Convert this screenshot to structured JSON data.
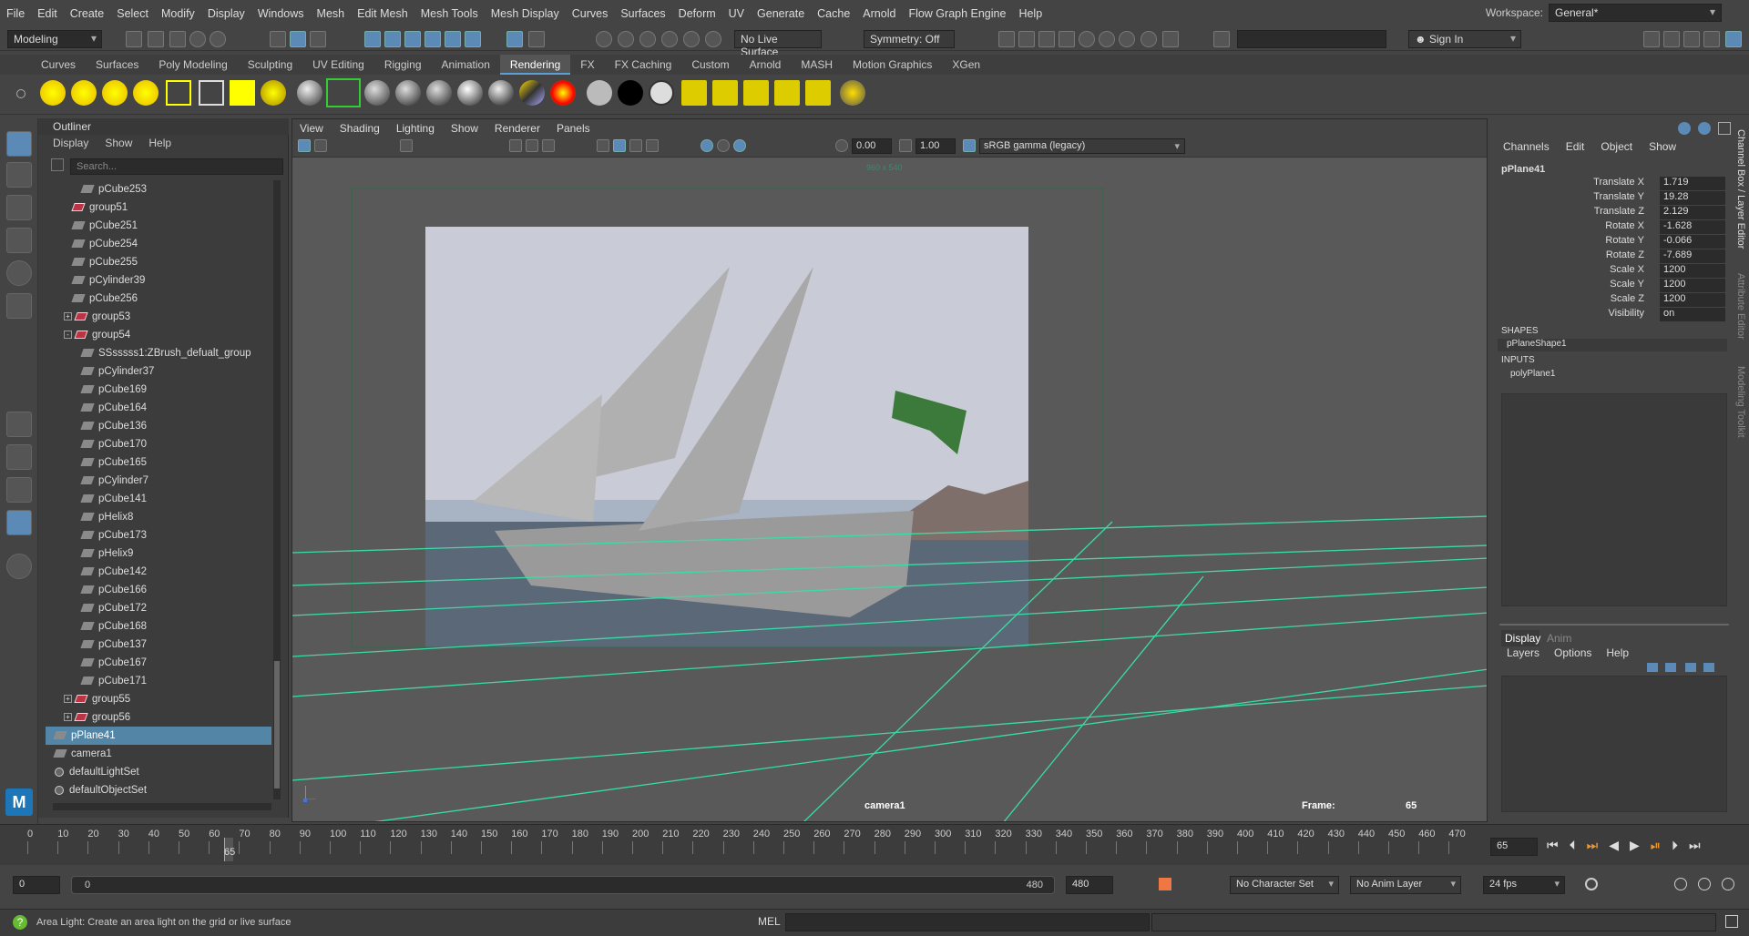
{
  "menubar": {
    "items": [
      "File",
      "Edit",
      "Create",
      "Select",
      "Modify",
      "Display",
      "Windows",
      "Mesh",
      "Edit Mesh",
      "Mesh Tools",
      "Mesh Display",
      "Curves",
      "Surfaces",
      "Deform",
      "UV",
      "Generate",
      "Cache",
      "Arnold",
      "Flow Graph Engine",
      "Help"
    ],
    "workspace_label": "Workspace:",
    "workspace_value": "General*"
  },
  "statusline": {
    "mode": "Modeling",
    "live_surface": "No Live Surface",
    "symmetry": "Symmetry: Off",
    "sign_in": "Sign In"
  },
  "shelf": {
    "tabs": [
      "Curves",
      "Surfaces",
      "Poly Modeling",
      "Sculpting",
      "UV Editing",
      "Rigging",
      "Animation",
      "Rendering",
      "FX",
      "FX Caching",
      "Custom",
      "Arnold",
      "MASH",
      "Motion Graphics",
      "XGen"
    ],
    "active_tab": "Rendering"
  },
  "outliner": {
    "title": "Outliner",
    "menu": [
      "Display",
      "Show",
      "Help"
    ],
    "search_placeholder": "Search...",
    "items": [
      {
        "label": "pCube253",
        "type": "mesh",
        "indent": 3
      },
      {
        "label": "group51",
        "type": "group",
        "indent": 2
      },
      {
        "label": "pCube251",
        "type": "mesh",
        "indent": 2
      },
      {
        "label": "pCube254",
        "type": "mesh",
        "indent": 2
      },
      {
        "label": "pCube255",
        "type": "mesh",
        "indent": 2
      },
      {
        "label": "pCylinder39",
        "type": "mesh",
        "indent": 2
      },
      {
        "label": "pCube256",
        "type": "mesh",
        "indent": 2
      },
      {
        "label": "group53",
        "type": "group",
        "indent": 1,
        "expand": "+"
      },
      {
        "label": "group54",
        "type": "group",
        "indent": 1,
        "expand": "-"
      },
      {
        "label": "SSsssss1:ZBrush_defualt_group",
        "type": "mesh",
        "indent": 3
      },
      {
        "label": "pCylinder37",
        "type": "mesh",
        "indent": 3
      },
      {
        "label": "pCube169",
        "type": "mesh",
        "indent": 3
      },
      {
        "label": "pCube164",
        "type": "mesh",
        "indent": 3
      },
      {
        "label": "pCube136",
        "type": "mesh",
        "indent": 3
      },
      {
        "label": "pCube170",
        "type": "mesh",
        "indent": 3
      },
      {
        "label": "pCube165",
        "type": "mesh",
        "indent": 3
      },
      {
        "label": "pCylinder7",
        "type": "mesh",
        "indent": 3
      },
      {
        "label": "pCube141",
        "type": "mesh",
        "indent": 3
      },
      {
        "label": "pHelix8",
        "type": "mesh",
        "indent": 3
      },
      {
        "label": "pCube173",
        "type": "mesh",
        "indent": 3
      },
      {
        "label": "pHelix9",
        "type": "mesh",
        "indent": 3
      },
      {
        "label": "pCube142",
        "type": "mesh",
        "indent": 3
      },
      {
        "label": "pCube166",
        "type": "mesh",
        "indent": 3
      },
      {
        "label": "pCube172",
        "type": "mesh",
        "indent": 3
      },
      {
        "label": "pCube168",
        "type": "mesh",
        "indent": 3
      },
      {
        "label": "pCube137",
        "type": "mesh",
        "indent": 3
      },
      {
        "label": "pCube167",
        "type": "mesh",
        "indent": 3
      },
      {
        "label": "pCube171",
        "type": "mesh",
        "indent": 3
      },
      {
        "label": "group55",
        "type": "group",
        "indent": 1,
        "expand": "+"
      },
      {
        "label": "group56",
        "type": "group",
        "indent": 1,
        "expand": "+"
      },
      {
        "label": "pPlane41",
        "type": "mesh",
        "indent": 0,
        "selected": true
      },
      {
        "label": "camera1",
        "type": "camera",
        "indent": 0
      },
      {
        "label": "defaultLightSet",
        "type": "set",
        "indent": 0
      },
      {
        "label": "defaultObjectSet",
        "type": "set",
        "indent": 0
      }
    ]
  },
  "viewport": {
    "menu": [
      "View",
      "Shading",
      "Lighting",
      "Show",
      "Renderer",
      "Panels"
    ],
    "exposure": "0.00",
    "gamma": "1.00",
    "colorspace": "sRGB gamma (legacy)",
    "resolution_gate": "960 x 540",
    "camera_label": "camera1",
    "frame_label": "Frame:",
    "frame_value": "65"
  },
  "channelbox": {
    "menu": [
      "Channels",
      "Edit",
      "Object",
      "Show"
    ],
    "object": "pPlane41",
    "attributes": [
      {
        "name": "Translate X",
        "value": "1.719"
      },
      {
        "name": "Translate Y",
        "value": "19.28"
      },
      {
        "name": "Translate Z",
        "value": "2.129"
      },
      {
        "name": "Rotate X",
        "value": "-1.628"
      },
      {
        "name": "Rotate Y",
        "value": "-0.066"
      },
      {
        "name": "Rotate Z",
        "value": "-7.689"
      },
      {
        "name": "Scale X",
        "value": "1200"
      },
      {
        "name": "Scale Y",
        "value": "1200"
      },
      {
        "name": "Scale Z",
        "value": "1200"
      },
      {
        "name": "Visibility",
        "value": "on"
      }
    ],
    "shapes_label": "SHAPES",
    "shape": "pPlaneShape1",
    "inputs_label": "INPUTS",
    "input": "polyPlane1",
    "layer_tabs": [
      "Display",
      "Anim"
    ],
    "layer_menu": [
      "Layers",
      "Options",
      "Help"
    ],
    "side_tabs": [
      "Channel Box / Layer Editor",
      "Attribute Editor",
      "Modeling Toolkit"
    ]
  },
  "timeslider": {
    "ticks": [
      "0",
      "10",
      "20",
      "30",
      "40",
      "50",
      "60",
      "70",
      "80",
      "90",
      "100",
      "110",
      "120",
      "130",
      "140",
      "150",
      "160",
      "170",
      "180",
      "190",
      "200",
      "210",
      "220",
      "230",
      "240",
      "250",
      "260",
      "270",
      "280",
      "290",
      "300",
      "310",
      "320",
      "330",
      "340",
      "350",
      "360",
      "370",
      "380",
      "390",
      "400",
      "410",
      "420",
      "430",
      "440",
      "450",
      "460",
      "470"
    ],
    "current_frame": "65",
    "current_field": "65"
  },
  "range": {
    "start": "0",
    "inner_start": "0",
    "inner_end": "480",
    "end": "480",
    "character_set": "No Character Set",
    "anim_layer": "No Anim Layer",
    "fps": "24 fps"
  },
  "helpline": {
    "message": "Area Light: Create an area light on the grid or live surface",
    "script_lang": "MEL"
  }
}
